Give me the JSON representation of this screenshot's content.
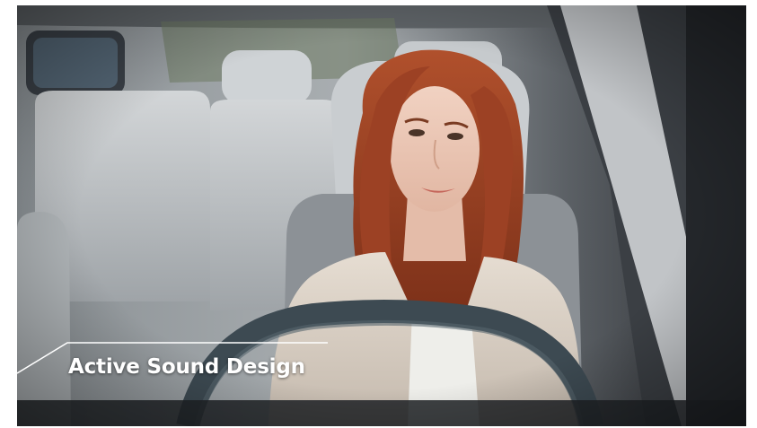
{
  "caption": {
    "text": "Active Sound Design"
  },
  "colors": {
    "caption_text": "#ffffff",
    "caption_line": "#ffffff",
    "hair": "#9a3f22",
    "interior": "#b9bec2",
    "jacket": "#d8cfc4"
  }
}
